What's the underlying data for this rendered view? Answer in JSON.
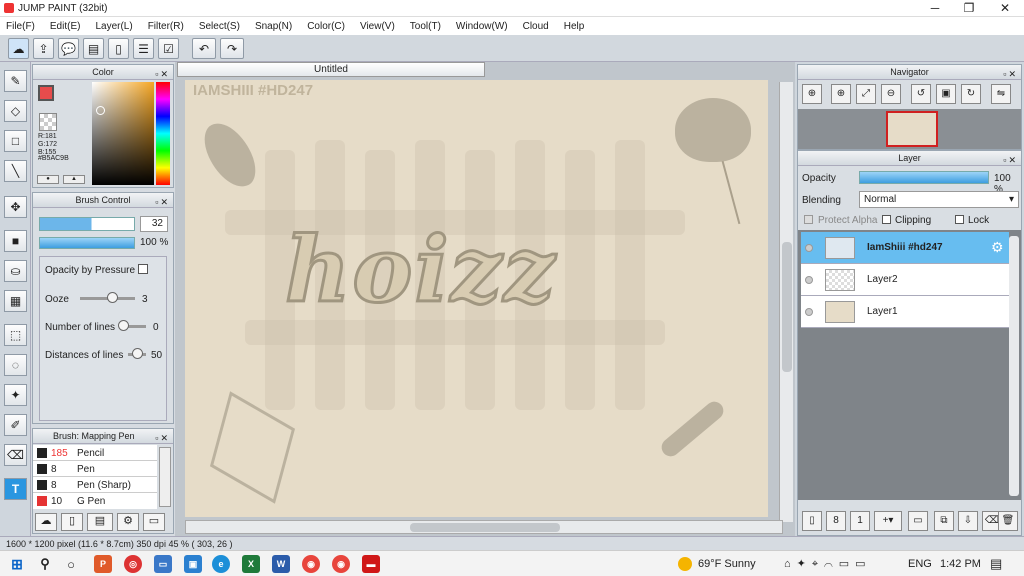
{
  "window": {
    "title": "JUMP PAINT (32bit)",
    "min": "─",
    "max": "❐",
    "close": "✕"
  },
  "menu": [
    "File(F)",
    "Edit(E)",
    "Layer(L)",
    "Filter(R)",
    "Select(S)",
    "Snap(N)",
    "Color(C)",
    "View(V)",
    "Tool(T)",
    "Window(W)",
    "Cloud",
    "Help"
  ],
  "toolbar": {
    "icons": [
      "cloud-sync-icon",
      "share-icon",
      "comment-icon",
      "message-icon",
      "document-icon",
      "list-icon",
      "checklist-icon",
      "undo-icon",
      "redo-icon"
    ]
  },
  "color_panel": {
    "title": "Color",
    "rgb": "R:181\nG:172\nB:155",
    "hex": "#B5AC9B",
    "main_color": "#e74c4c",
    "sub_color": "#b5ac9b"
  },
  "brush_control": {
    "title": "Brush Control",
    "size": "32",
    "opacity": "100 %",
    "opacity_by_pressure": "Opacity by Pressure",
    "ooze_label": "Ooze",
    "ooze_value": "3",
    "lines_label": "Number of lines",
    "lines_value": "0",
    "dist_label": "Distances of lines",
    "dist_value": "50"
  },
  "brush_list": {
    "title": "Brush: Mapping Pen",
    "items": [
      {
        "size": "185",
        "name": "Pencil",
        "color": "#222222"
      },
      {
        "size": "8",
        "name": "Pen",
        "color": "#222222"
      },
      {
        "size": "8",
        "name": "Pen (Sharp)",
        "color": "#222222"
      },
      {
        "size": "10",
        "name": "G Pen",
        "color": "#e53333"
      }
    ]
  },
  "canvas": {
    "tab": "Untitled",
    "text_top": "IAMSHIII #HD247",
    "text_main": "hoizz"
  },
  "navigator": {
    "title": "Navigator"
  },
  "layer_panel": {
    "title": "Layer",
    "opacity_label": "Opacity",
    "opacity_value": "100 %",
    "blending_label": "Blending",
    "blending_value": "Normal",
    "protect_alpha": "Protect Alpha",
    "clipping": "Clipping",
    "lock": "Lock",
    "layers": [
      {
        "name": "IamShiii #hd247",
        "selected": true
      },
      {
        "name": "Layer2",
        "selected": false
      },
      {
        "name": "Layer1",
        "selected": false
      }
    ]
  },
  "status": {
    "text": "1600 * 1200 pixel  (11.6 * 8.7cm)  350 dpi  45 %  ( 303, 26 )"
  },
  "taskbar": {
    "weather": "69°F  Sunny",
    "lang": "ENG",
    "time": "1:42 PM"
  }
}
